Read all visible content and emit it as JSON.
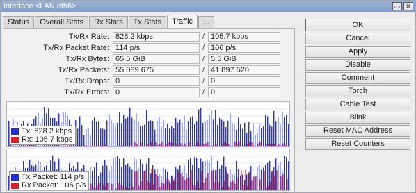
{
  "window": {
    "title": "Interface <LAN eth6>",
    "minimize_label": "▭",
    "close_label": "✕"
  },
  "tabs": [
    {
      "label": "Status"
    },
    {
      "label": "Overall Stats"
    },
    {
      "label": "Rx Stats"
    },
    {
      "label": "Tx Stats"
    },
    {
      "label": "Traffic",
      "active": true
    },
    {
      "label": "..."
    }
  ],
  "stats": [
    {
      "label": "Tx/Rx Rate:",
      "tx": "828.2 kbps",
      "sep": "/",
      "rx": "105.7 kbps"
    },
    {
      "label": "Tx/Rx Packet Rate:",
      "tx": "114 p/s",
      "sep": "/",
      "rx": "106 p/s"
    },
    {
      "label": "Tx/Rx Bytes:",
      "tx": "65.5 GiB",
      "sep": "/",
      "rx": "5.5 GiB"
    },
    {
      "label": "Tx/Rx Packets:",
      "tx": "55 089 675",
      "sep": "/",
      "rx": "41 897 520"
    },
    {
      "label": "Tx/Rx Drops:",
      "tx": "0",
      "sep": "/",
      "rx": "0"
    },
    {
      "label": "Tx/Rx Errors:",
      "tx": "0",
      "sep": "/",
      "rx": "0"
    }
  ],
  "graphs": {
    "traffic": {
      "legend": [
        {
          "text": "Tx:  828.2 kbps",
          "color": "#1f2fd6"
        },
        {
          "text": "Rx:  105.7 kbps",
          "color": "#d8202a"
        }
      ]
    },
    "packets": {
      "legend": [
        {
          "text": "Tx Packet:  114 p/s",
          "color": "#1f2fd6"
        },
        {
          "text": "Rx Packet:  106 p/s",
          "color": "#d8202a"
        }
      ]
    }
  },
  "buttons": {
    "ok": "OK",
    "cancel": "Cancel",
    "apply": "Apply",
    "disable": "Disable",
    "comment": "Comment",
    "torch": "Torch",
    "cable_test": "Cable Test",
    "blink": "Blink",
    "reset_mac": "Reset MAC Address",
    "reset_counters": "Reset Counters"
  }
}
